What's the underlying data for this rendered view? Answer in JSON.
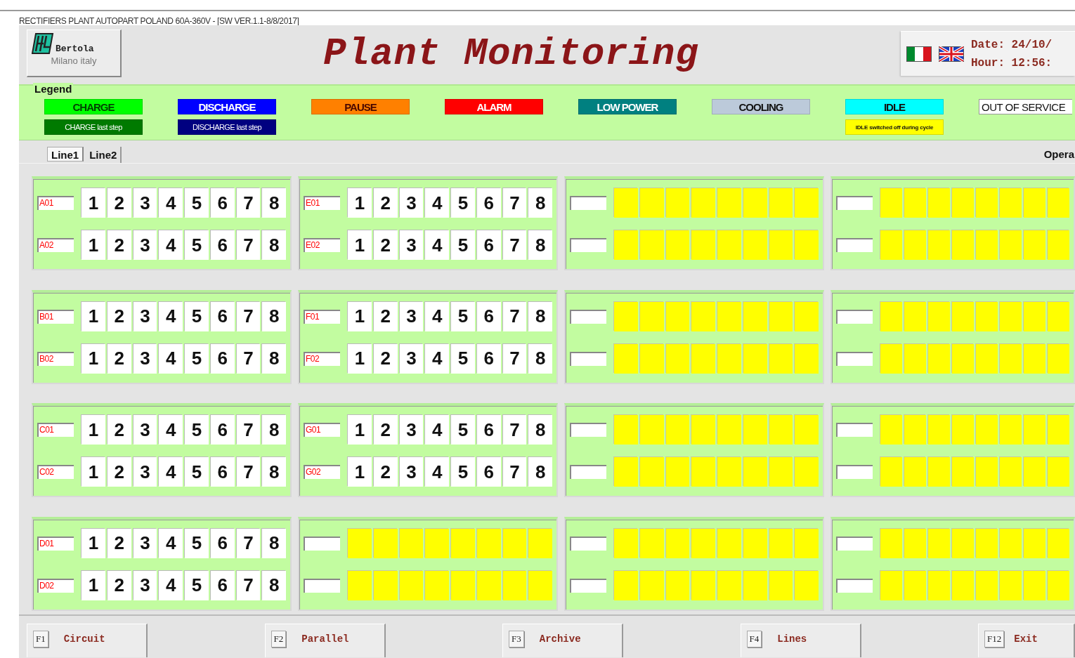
{
  "window": {
    "title": "RECTIFIERS PLANT AUTOPART POLAND 60A-360V - [SW VER.1.1-8/8/2017]"
  },
  "logo": {
    "name": "Bertola",
    "place": "Milano italy"
  },
  "title": "Plant Monitoring",
  "clock": {
    "date": "Date: 24/10/",
    "hour": "Hour: 12:56:"
  },
  "legend": {
    "title": "Legend",
    "items": [
      {
        "label": "CHARGE",
        "color": "#00ff00",
        "sub": {
          "label": "CHARGE last step",
          "color": "#007a00"
        }
      },
      {
        "label": "DISCHARGE",
        "color": "#0000ff",
        "sub": {
          "label": "DISCHARGE last step",
          "color": "#000080"
        }
      },
      {
        "label": "PAUSE",
        "color": "#ff8000"
      },
      {
        "label": "ALARM",
        "color": "#ff0000"
      },
      {
        "label": "LOW POWER",
        "color": "#008080"
      },
      {
        "label": "COOLING",
        "color": "#bccada"
      },
      {
        "label": "IDLE",
        "color": "#00ffff",
        "sub": {
          "label": "IDLE switched off during cycle",
          "color": "#ffff00"
        }
      },
      {
        "label": "OUT OF SERVICE",
        "color": "#ffffff"
      }
    ]
  },
  "tabs": [
    {
      "label": "Line1",
      "selected": true
    },
    {
      "label": "Line2",
      "selected": false
    }
  ],
  "operator_label": "Opera",
  "panels": [
    {
      "rows": [
        {
          "kind": "active",
          "label": "A01",
          "cells": [
            "1",
            "2",
            "3",
            "4",
            "5",
            "6",
            "7",
            "8"
          ]
        },
        {
          "kind": "active",
          "label": "A02",
          "cells": [
            "1",
            "2",
            "3",
            "4",
            "5",
            "6",
            "7",
            "8"
          ]
        }
      ]
    },
    {
      "rows": [
        {
          "kind": "active",
          "label": "E01",
          "cells": [
            "1",
            "2",
            "3",
            "4",
            "5",
            "6",
            "7",
            "8"
          ]
        },
        {
          "kind": "active",
          "label": "E02",
          "cells": [
            "1",
            "2",
            "3",
            "4",
            "5",
            "6",
            "7",
            "8"
          ]
        }
      ]
    },
    {
      "rows": [
        {
          "kind": "unused"
        },
        {
          "kind": "unused"
        }
      ]
    },
    {
      "rows": [
        {
          "kind": "unused"
        },
        {
          "kind": "unused"
        }
      ]
    },
    {
      "rows": [
        {
          "kind": "active",
          "label": "B01",
          "cells": [
            "1",
            "2",
            "3",
            "4",
            "5",
            "6",
            "7",
            "8"
          ]
        },
        {
          "kind": "active",
          "label": "B02",
          "cells": [
            "1",
            "2",
            "3",
            "4",
            "5",
            "6",
            "7",
            "8"
          ]
        }
      ]
    },
    {
      "rows": [
        {
          "kind": "active",
          "label": "F01",
          "cells": [
            "1",
            "2",
            "3",
            "4",
            "5",
            "6",
            "7",
            "8"
          ]
        },
        {
          "kind": "active",
          "label": "F02",
          "cells": [
            "1",
            "2",
            "3",
            "4",
            "5",
            "6",
            "7",
            "8"
          ]
        }
      ]
    },
    {
      "rows": [
        {
          "kind": "unused"
        },
        {
          "kind": "unused"
        }
      ]
    },
    {
      "rows": [
        {
          "kind": "unused"
        },
        {
          "kind": "unused"
        }
      ]
    },
    {
      "rows": [
        {
          "kind": "active",
          "label": "C01",
          "cells": [
            "1",
            "2",
            "3",
            "4",
            "5",
            "6",
            "7",
            "8"
          ]
        },
        {
          "kind": "active",
          "label": "C02",
          "cells": [
            "1",
            "2",
            "3",
            "4",
            "5",
            "6",
            "7",
            "8"
          ]
        }
      ]
    },
    {
      "rows": [
        {
          "kind": "active",
          "label": "G01",
          "cells": [
            "1",
            "2",
            "3",
            "4",
            "5",
            "6",
            "7",
            "8"
          ]
        },
        {
          "kind": "active",
          "label": "G02",
          "cells": [
            "1",
            "2",
            "3",
            "4",
            "5",
            "6",
            "7",
            "8"
          ]
        }
      ]
    },
    {
      "rows": [
        {
          "kind": "unused"
        },
        {
          "kind": "unused"
        }
      ]
    },
    {
      "rows": [
        {
          "kind": "unused"
        },
        {
          "kind": "unused"
        }
      ]
    },
    {
      "rows": [
        {
          "kind": "active",
          "label": "D01",
          "cells": [
            "1",
            "2",
            "3",
            "4",
            "5",
            "6",
            "7",
            "8"
          ]
        },
        {
          "kind": "active",
          "label": "D02",
          "cells": [
            "1",
            "2",
            "3",
            "4",
            "5",
            "6",
            "7",
            "8"
          ]
        }
      ]
    },
    {
      "rows": [
        {
          "kind": "unused"
        },
        {
          "kind": "unused"
        }
      ]
    },
    {
      "rows": [
        {
          "kind": "unused"
        },
        {
          "kind": "unused"
        }
      ]
    },
    {
      "rows": [
        {
          "kind": "unused"
        },
        {
          "kind": "unused"
        }
      ]
    }
  ],
  "function_keys": [
    {
      "key": "F1",
      "label": "Circuit"
    },
    {
      "key": "F2",
      "label": "Parallel"
    },
    {
      "key": "F3",
      "label": "Archive"
    },
    {
      "key": "F4",
      "label": "Lines"
    },
    {
      "key": "F12",
      "label": "Exit"
    }
  ]
}
